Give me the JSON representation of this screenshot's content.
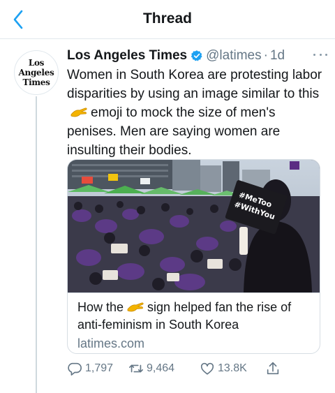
{
  "header": {
    "title": "Thread"
  },
  "tweet": {
    "author": {
      "name": "Los Angeles Times",
      "handle": "@latimes",
      "avatar_lines": [
        "Los",
        "Angeles",
        "Times"
      ]
    },
    "separator": "·",
    "time": "1d",
    "text_parts": [
      "Women in South Korea are protesting labor disparities by using an image similar to this",
      "emoji to mock the size of men's penises. Men are saying women are insulting their bodies."
    ],
    "card": {
      "title_parts": [
        "How the",
        "sign helped fan the rise of anti-feminism in South Korea"
      ],
      "domain": "latimes.com",
      "image_sign_lines": [
        "#MeToo",
        "#WithYou"
      ]
    },
    "actions": {
      "reply_count": "1,797",
      "retweet_count": "9,464",
      "like_count": "13.8K"
    }
  },
  "colors": {
    "accent": "#1da1f2",
    "secondary_text": "#657786",
    "border": "#e1e8ed"
  },
  "icons": [
    "back-arrow-icon",
    "verified-badge-icon",
    "more-icon",
    "pinching-hand-emoji",
    "reply-icon",
    "retweet-icon",
    "like-icon",
    "share-icon"
  ]
}
